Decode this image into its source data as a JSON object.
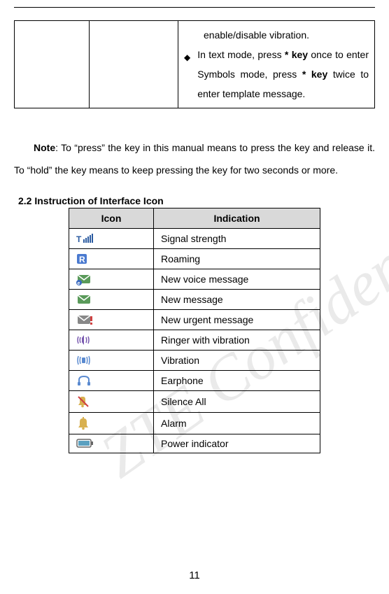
{
  "top_cell": {
    "line1_pre": "enable/disable vibration.",
    "line2": {
      "pre": "In text mode, press ",
      "key1": "* key",
      "mid1": " once to enter Symbols mode, press ",
      "key2": "* key",
      "post": " twice to enter template message."
    }
  },
  "note": {
    "label": "Note",
    "text": ": To “press” the key in this manual means to press the key and release it. To “hold” the key means to keep pressing the key for two seconds or more."
  },
  "section_heading": "2.2 Instruction of Interface Icon",
  "table": {
    "headers": {
      "icon": "Icon",
      "indication": "Indication"
    },
    "rows": [
      {
        "icon": "signal-strength",
        "label": "Signal strength"
      },
      {
        "icon": "roaming",
        "label": "Roaming"
      },
      {
        "icon": "voice-message",
        "label": "New voice message"
      },
      {
        "icon": "new-message",
        "label": "New message"
      },
      {
        "icon": "urgent-message",
        "label": "New urgent message"
      },
      {
        "icon": "ringer-vibration",
        "label": "Ringer with vibration"
      },
      {
        "icon": "vibration",
        "label": "Vibration"
      },
      {
        "icon": "earphone",
        "label": "Earphone"
      },
      {
        "icon": "silence-all",
        "label": "Silence All"
      },
      {
        "icon": "alarm",
        "label": "Alarm"
      },
      {
        "icon": "power-indicator",
        "label": "Power indicator"
      }
    ]
  },
  "page_number": "11",
  "watermark_text": "ZTE Confidential"
}
